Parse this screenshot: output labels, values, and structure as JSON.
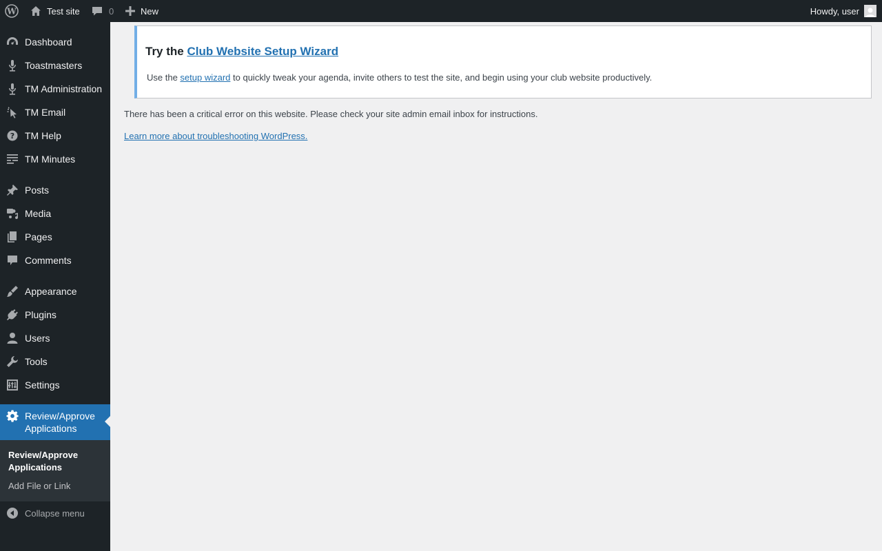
{
  "adminbar": {
    "wp_logo_icon": "wordpress-logo-icon",
    "site_name": "Test site",
    "comments_count": "0",
    "new_label": "New",
    "howdy": "Howdy, user"
  },
  "sidebar": {
    "items": [
      {
        "label": "Dashboard",
        "icon": "dashboard-icon"
      },
      {
        "label": "Toastmasters",
        "icon": "microphone-icon"
      },
      {
        "label": "TM Administration",
        "icon": "microphone-icon"
      },
      {
        "label": "TM Email",
        "icon": "cursor-icon"
      },
      {
        "label": "TM Help",
        "icon": "help-icon"
      },
      {
        "label": "TM Minutes",
        "icon": "text-lines-icon"
      },
      {
        "label": "Posts",
        "icon": "pushpin-icon"
      },
      {
        "label": "Media",
        "icon": "media-icon"
      },
      {
        "label": "Pages",
        "icon": "pages-icon"
      },
      {
        "label": "Comments",
        "icon": "comment-icon"
      },
      {
        "label": "Appearance",
        "icon": "paintbrush-icon"
      },
      {
        "label": "Plugins",
        "icon": "plug-icon"
      },
      {
        "label": "Users",
        "icon": "user-icon"
      },
      {
        "label": "Tools",
        "icon": "wrench-icon"
      },
      {
        "label": "Settings",
        "icon": "settings-icon"
      }
    ],
    "current": {
      "label": "Review/Approve Applications",
      "icon": "gear-icon"
    },
    "submenu": {
      "current_label": "Review/Approve Applications",
      "add_label": "Add File or Link"
    },
    "collapse_label": "Collapse menu"
  },
  "notice": {
    "title_prefix": "Try the ",
    "title_link": "Club Website Setup Wizard",
    "text_prefix": "Use the ",
    "text_link": "setup wizard",
    "text_suffix": " to quickly tweak your agenda, invite others to test the site, and begin using your club website productively."
  },
  "error": {
    "message": "There has been a critical error on this website. Please check your site admin email inbox for instructions.",
    "learn_more": "Learn more about troubleshooting WordPress."
  },
  "colors": {
    "adminbar_bg": "#1d2327",
    "accent": "#2271b1",
    "notice_border": "#72aee6"
  }
}
